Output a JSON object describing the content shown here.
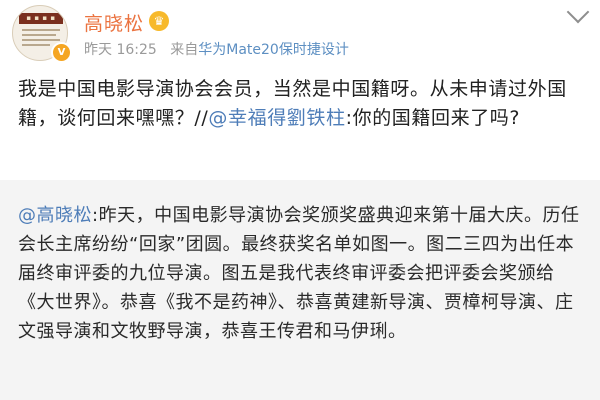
{
  "post": {
    "author": "高晓松",
    "time": "昨天 16:25",
    "via_prefix": "来自",
    "device": "华为Mate20保时捷设计",
    "text_before": "我是中国电影导演协会会员，当然是中国籍呀。从未申请过外国籍，谈何回来嘿嘿？//",
    "reply_mention": "@幸福得劉铁柱",
    "text_after": ":你的国籍回来了吗?"
  },
  "repost": {
    "mention": "@高晓松",
    "text": ":昨天，中国电影导演协会奖颁奖盛典迎来第十届大庆。历任会长主席纷纷“回家”团圆。最终获奖名单如图一。图二三四为出任本届终审评委的九位导演。图五是我代表终审评委会把评委会奖颁给《大世界》。恭喜《我不是药神》、恭喜黄建新导演、贾樟柯导演、庄文强导演和文牧野导演，恭喜王传君和马伊琍。"
  }
}
